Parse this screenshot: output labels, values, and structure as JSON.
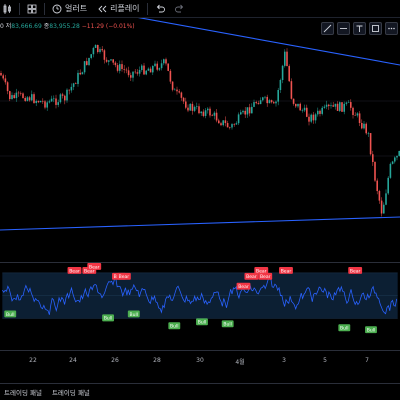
{
  "toolbar": {
    "items": [
      {
        "name": "chart-type",
        "label": "",
        "icon": "candles-icon"
      },
      {
        "name": "indicators",
        "label": "",
        "icon": "grid-icon"
      },
      {
        "name": "alert",
        "label": "얼러트",
        "icon": "clock-icon"
      },
      {
        "name": "replay",
        "label": "리플레이",
        "icon": "rewind-icon"
      },
      {
        "name": "undo",
        "label": "",
        "icon": "undo-icon"
      },
      {
        "name": "redo",
        "label": "",
        "icon": "redo-icon"
      }
    ]
  },
  "legend": {
    "low_label": "저",
    "low_value": "83,666.69",
    "close_label": "종",
    "close_value": "83,955.28",
    "change": "−11.29 (−0.01%)",
    "left_prefix": "0"
  },
  "time_axis": {
    "labels": [
      "22",
      "24",
      "26",
      "28",
      "30",
      "4월",
      "3",
      "5",
      "7"
    ]
  },
  "bottom_tabs": [
    "트레이딩 패널",
    "트레이딩 패널"
  ],
  "colors": {
    "background": "#000000",
    "up": "#26a69a",
    "down": "#ef5350",
    "trendline": "#2962ff",
    "oscillator": "#2962ff",
    "bull_label": "#4caf50",
    "bear_label": "#f23645",
    "band_fill": "#0c1f33"
  },
  "chart_data": {
    "type": "candlestick",
    "series": [
      {
        "name": "price"
      },
      {
        "name": "oscillator"
      }
    ],
    "x_tick_labels": [
      "22",
      "24",
      "26",
      "28",
      "30",
      "4월",
      "3",
      "5",
      "7"
    ],
    "bear_signals": 11,
    "bull_signals": 8,
    "signal_labels": {
      "bear": "Bear",
      "bull": "Bull"
    }
  }
}
